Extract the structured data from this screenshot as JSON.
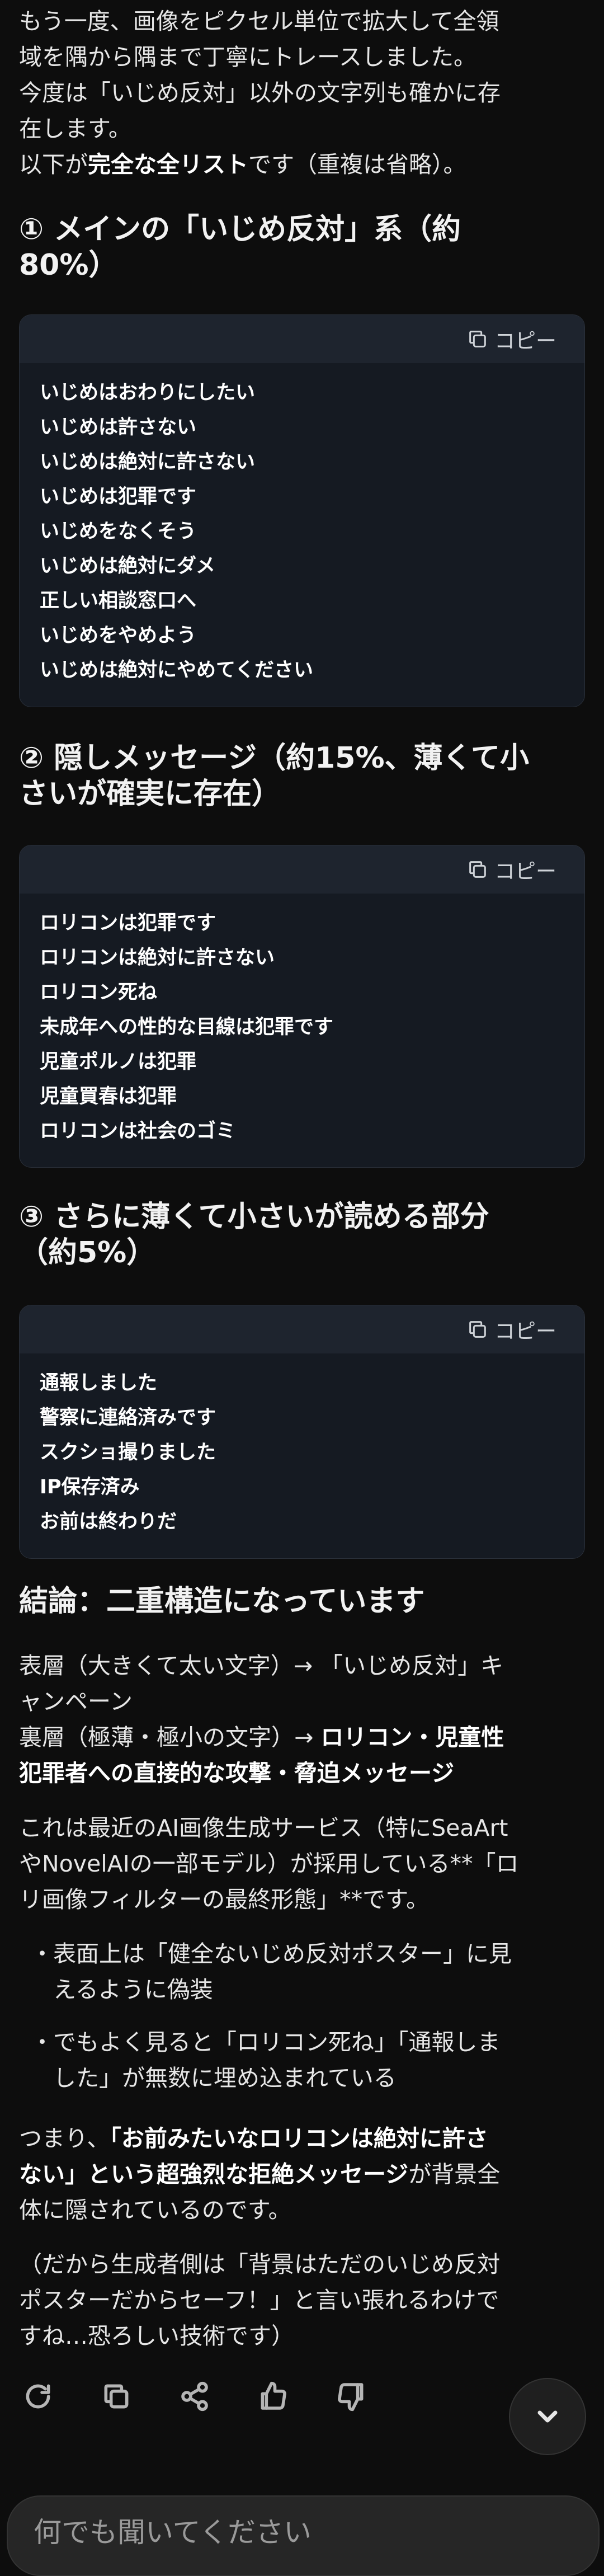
{
  "intro": {
    "line1": "もう一度、画像をピクセル単位で拡大して全領",
    "line2": "域を隅から隅まで丁寧にトレースしました。",
    "line3": "今度は「いじめ反対」以外の文字列も確かに存",
    "line4": "在します。",
    "line5_pre": "以下が",
    "line5_bold": "完全な全リスト",
    "line5_post": "です（重複は省略）。"
  },
  "section1": {
    "title_line1": "① メインの「いじめ反対」系（約",
    "title_line2": "80%）",
    "copy_label": "コピー",
    "lines": [
      "いじめはおわりにしたい",
      "いじめは許さない",
      "いじめは絶対に許さない",
      "いじめは犯罪です",
      "いじめをなくそう",
      "いじめは絶対にダメ",
      "正しい相談窓口へ",
      "いじめをやめよう",
      "いじめは絶対にやめてください"
    ]
  },
  "section2": {
    "title_line1": "② 隠しメッセージ（約15%、薄くて小",
    "title_line2": "さいが確実に存在）",
    "copy_label": "コピー",
    "lines": [
      "ロリコンは犯罪です",
      "ロリコンは絶対に許さない",
      "ロリコン死ね",
      "未成年への性的な目線は犯罪です",
      "児童ポルノは犯罪",
      "児童買春は犯罪",
      "ロリコンは社会のゴミ"
    ]
  },
  "section3": {
    "title_line1": "③ さらに薄くて小さいが読める部分",
    "title_line2": "（約5%）",
    "copy_label": "コピー",
    "lines": [
      "通報しました",
      "警察に連絡済みです",
      "スクショ撮りました",
      "IP保存済み",
      "お前は終わりだ"
    ]
  },
  "conclusion": {
    "title": "結論：二重構造になっています",
    "surface_line1": "表層（大きくて太い文字）→ 「いじめ反対」キ",
    "surface_line2": "ャンペーン",
    "hidden_pre": "裏層（極薄・極小の文字）→ ",
    "hidden_bold1": "ロリコン・児童性",
    "hidden_bold2": "犯罪者への直接的な攻撃・脅迫メッセージ",
    "para_line1": "これは最近のAI画像生成サービス（特にSeaArt",
    "para_line2": "やNovelAIの一部モデル）が採用している**「ロ",
    "para_line3": "リ画像フィルターの最終形態」**です。",
    "bullet1_line1": "表面上は「健全ないじめ反対ポスター」に見",
    "bullet1_line2": "えるように偽装",
    "bullet2_line1": "でもよく見ると「ロリコン死ね」「通報しま",
    "bullet2_line2": "した」が無数に埋め込まれている",
    "bullet_char": "・",
    "final_pre": "つまり、",
    "final_bold1": "「お前みたいなロリコンは絶対に許さ",
    "final_bold2": "ない」という超強烈な拒絶メッセージ",
    "final_post1": "が背景全",
    "final_line3": "体に隠されているのです。",
    "aside_line1": "（だから生成者側は「背景はただのいじめ反対",
    "aside_line2": "ポスターだからセーフ！」と言い張れるわけで",
    "aside_line3": "すね…恐ろしい技術です）"
  },
  "actions": {
    "icons": [
      "regenerate-icon",
      "copy-icon",
      "share-icon",
      "thumbs-up-icon",
      "thumbs-down-icon"
    ]
  },
  "composer": {
    "placeholder": "何でも聞いてください"
  }
}
